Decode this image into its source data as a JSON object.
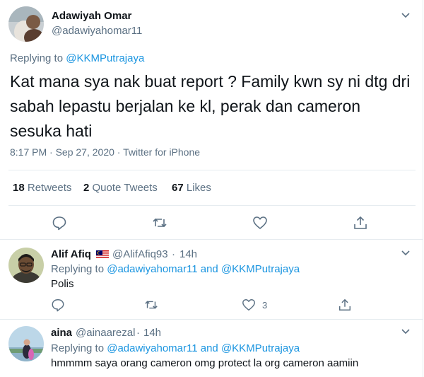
{
  "main_tweet": {
    "author_name": "Adawiyah Omar",
    "author_handle": "@adawiyahomar11",
    "replying_prefix": "Replying to",
    "replying_to": "@KKMPutrajaya",
    "text": "Kat mana sya nak buat report ? Family kwn sy ni dtg dri sabah lepastu berjalan ke kl, perak dan cameron sesuka hati",
    "time": "8:17 PM",
    "date": "Sep 27, 2020",
    "source": "Twitter for iPhone",
    "retweets_count": "18",
    "retweets_label": "Retweets",
    "quotes_count": "2",
    "quotes_label": "Quote Tweets",
    "likes_count": "67",
    "likes_label": "Likes"
  },
  "replies": [
    {
      "author_name": "Alif Afiq",
      "author_handle": "@AlifAfiq93",
      "age": "14h",
      "replying_prefix": "Replying to",
      "mention1": "@adawiyahomar11",
      "and": "and",
      "mention2": "@KKMPutrajaya",
      "text": "Polis",
      "like_count": "3"
    },
    {
      "author_name": "aina",
      "author_handle": "@ainaarezal",
      "age": "14h",
      "replying_prefix": "Replying to",
      "mention1": "@adawiyahomar11",
      "and": "and",
      "mention2": "@KKMPutrajaya",
      "text": "hmmmm saya orang cameron omg protect la org cameron aamiin"
    }
  ],
  "separator": "·",
  "icons": {
    "more": "chevron-down-icon",
    "reply": "reply-icon",
    "retweet": "retweet-icon",
    "like": "heart-icon",
    "share": "share-icon",
    "flag": "malaysia-flag-icon"
  },
  "colors": {
    "link": "#1b95e0",
    "muted": "#5b7083",
    "text": "#0f1419",
    "divider": "#e6ecf0"
  }
}
